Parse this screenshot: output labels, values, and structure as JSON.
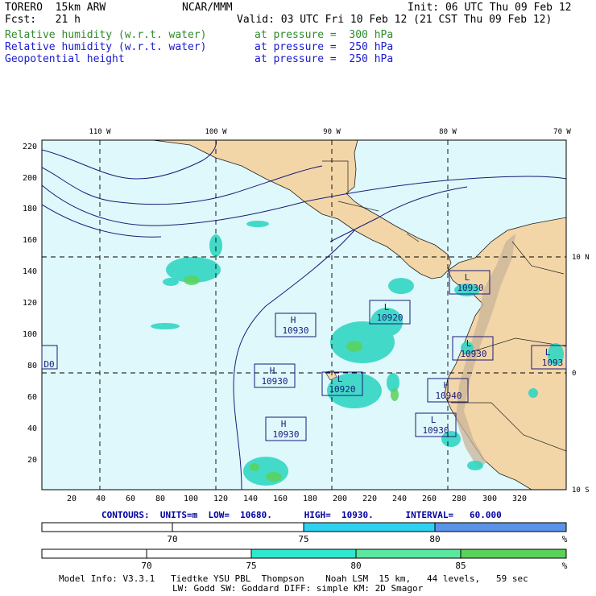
{
  "header": {
    "model": "TORERO  15km ARW",
    "org": "NCAR/MMM",
    "init": "Init: 06 UTC Thu 09 Feb 12",
    "fcst": "Fcst:   21 h",
    "valid": "Valid: 03 UTC Fri 10 Feb 12 (21 CST Thu 09 Feb 12)"
  },
  "fields": [
    {
      "name": "Relative humidity (w.r.t. water)",
      "level": "at pressure =  300 hPa",
      "color": "#2e8b2e"
    },
    {
      "name": "Relative humidity (w.r.t. water)",
      "level": "at pressure =  250 hPa",
      "color": "#1a1ad0"
    },
    {
      "name": "Geopotential height",
      "level": "at pressure =  250 hPa",
      "color": "#1a1ad0"
    }
  ],
  "axes": {
    "top_lon": [
      "110 W",
      "100 W",
      "90 W",
      "80 W",
      "70 W"
    ],
    "right_lat": [
      "10 N",
      "0",
      "10 S"
    ],
    "left_y": [
      "220",
      "200",
      "180",
      "160",
      "140",
      "120",
      "100",
      "80",
      "60",
      "40",
      "20"
    ],
    "bottom_x": [
      "20",
      "40",
      "60",
      "80",
      "100",
      "120",
      "140",
      "160",
      "180",
      "200",
      "220",
      "240",
      "260",
      "280",
      "300",
      "320"
    ]
  },
  "contour_labels": [
    {
      "letter": "H",
      "value": "10930"
    },
    {
      "letter": "H",
      "value": "10930"
    },
    {
      "letter": "H",
      "value": "10930"
    },
    {
      "letter": "L",
      "value": "10920"
    },
    {
      "letter": "L",
      "value": "10920"
    },
    {
      "letter": "L",
      "value": "10930"
    },
    {
      "letter": "L",
      "value": "10930"
    },
    {
      "letter": "H",
      "value": "10940"
    },
    {
      "letter": "L",
      "value": "10930"
    },
    {
      "letter": "L",
      "value": "1093"
    },
    {
      "letter": "",
      "value": "D0"
    }
  ],
  "contours_info": {
    "label": "CONTOURS:  UNITS=m  LOW=  10680.      HIGH=  10930.      INTERVAL=   60.000"
  },
  "colorbar1": {
    "labels": [
      "70",
      "75",
      "80"
    ],
    "unit": "%",
    "colors": [
      "#ffffff",
      "#2ed2f0",
      "#5a94e8"
    ]
  },
  "colorbar2": {
    "labels": [
      "70",
      "75",
      "80",
      "85"
    ],
    "unit": "%",
    "colors": [
      "#ffffff",
      "#2ee8d0",
      "#5ae8a0",
      "#5ad25a"
    ]
  },
  "footer": {
    "line1": "Model Info: V3.3.1   Tiedtke YSU PBL  Thompson    Noah LSM  15 km,   44 levels,   59 sec",
    "line2": "LW: Godd SW: Goddard DIFF: simple KM: 2D Smagor"
  },
  "colors": {
    "ocean": "#dff8fb",
    "land": "#f3d6a8",
    "mountain": "#c9b49a",
    "rh": "#33d6c4",
    "rh_dark": "#5ad25a",
    "contour": "#1a1a7a",
    "label_box": "#1a1a7a"
  }
}
